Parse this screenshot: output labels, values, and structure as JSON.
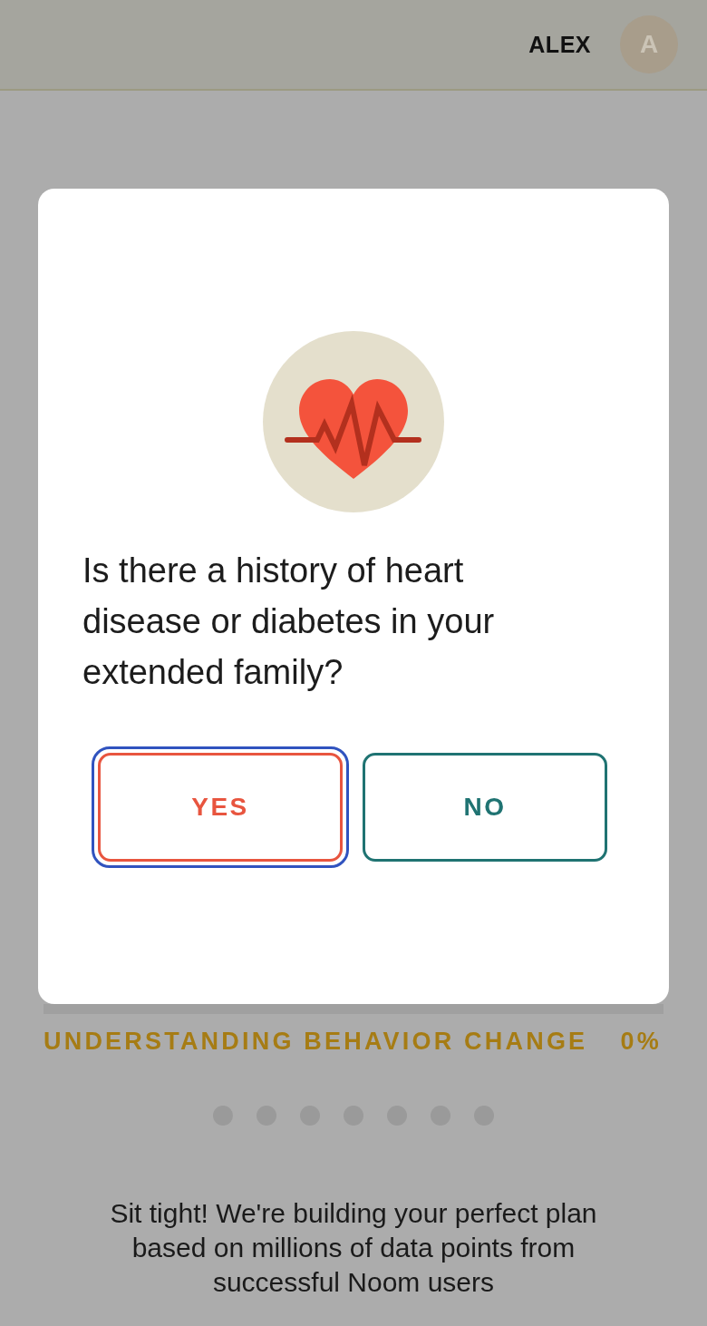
{
  "header": {
    "user_name": "ALEX",
    "avatar_initial": "A"
  },
  "dialog": {
    "question": "Is there a history of heart disease or diabetes in your extended family?",
    "answers": [
      {
        "label": "YES",
        "color": "#e8553f",
        "focused": true
      },
      {
        "label": "NO",
        "color": "#1f7372",
        "focused": false
      }
    ]
  },
  "progress": {
    "label": "UNDERSTANDING BEHAVIOR CHANGE",
    "reading": "0%",
    "level": 0
  },
  "page_dots": [
    {
      "selected": false
    },
    {
      "selected": false
    },
    {
      "selected": false
    },
    {
      "selected": false
    },
    {
      "selected": false
    },
    {
      "selected": false
    },
    {
      "selected": false
    }
  ],
  "message": "Sit tight! We're building your perfect plan based on millions of data points from successful Noom users"
}
